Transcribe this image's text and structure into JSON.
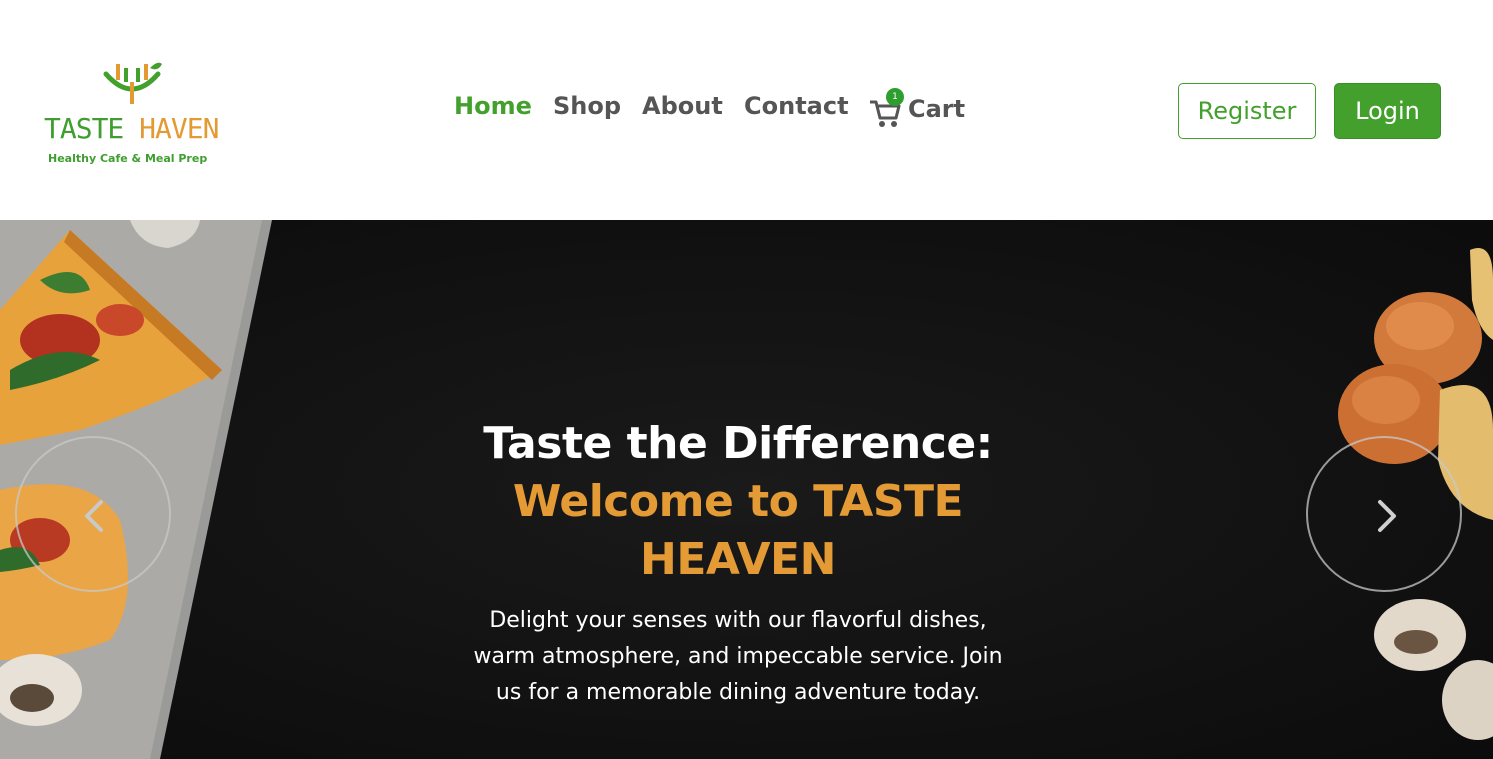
{
  "brand": {
    "name_part1": "TASTE",
    "name_part2": "HAVEN",
    "tagline": "Healthy Cafe & Meal Prep",
    "colors": {
      "green": "#43a02c",
      "orange": "#e49a32"
    }
  },
  "nav": {
    "items": [
      {
        "label": "Home",
        "active": true
      },
      {
        "label": "Shop",
        "active": false
      },
      {
        "label": "About",
        "active": false
      },
      {
        "label": "Contact",
        "active": false
      }
    ],
    "cart": {
      "label": "Cart",
      "count": "1",
      "icon": "cart-icon"
    }
  },
  "auth": {
    "register_label": "Register",
    "login_label": "Login"
  },
  "hero": {
    "title_line1": "Taste the Difference:",
    "title_line2": "Welcome to TASTE HEAVEN",
    "subtitle": "Delight your senses with our flavorful dishes, warm atmosphere, and impeccable service. Join us for a memorable dining adventure today.",
    "prev_icon": "chevron-left-icon",
    "next_icon": "chevron-right-icon",
    "colors": {
      "background": "#121212",
      "accent": "#e59b35"
    }
  }
}
